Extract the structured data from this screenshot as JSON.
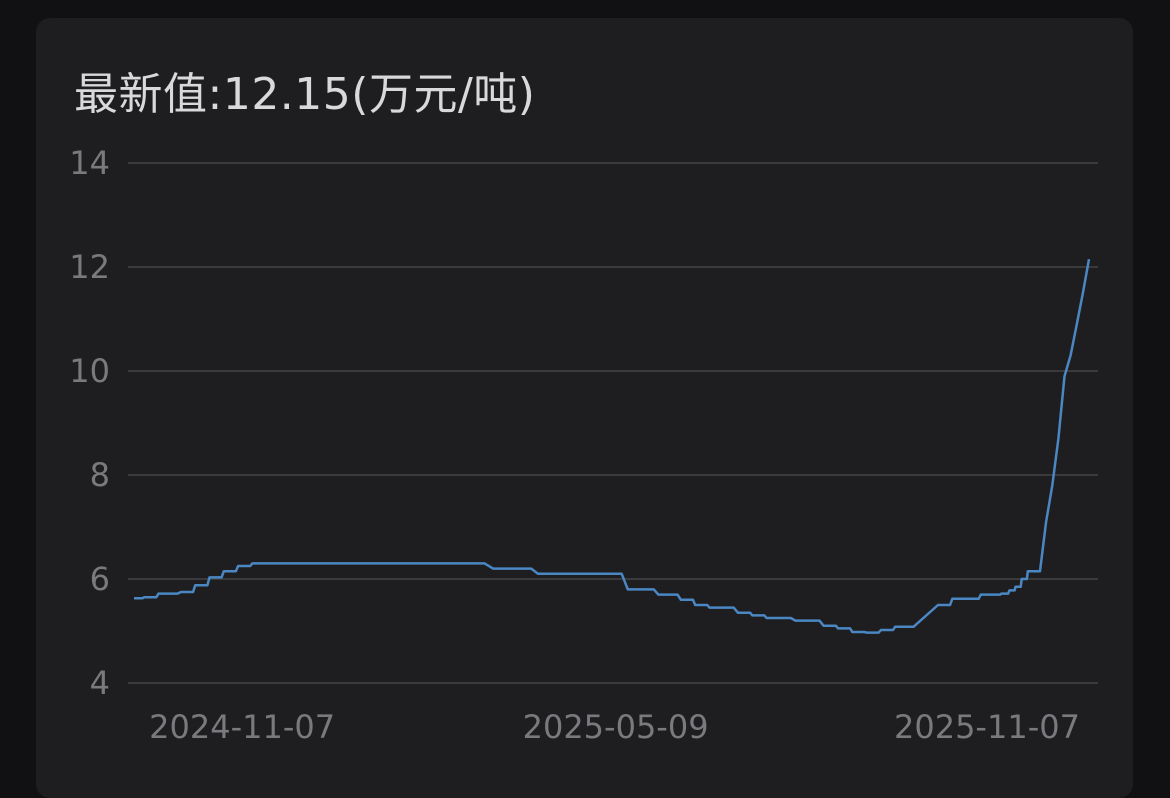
{
  "header": {
    "title": "最新值:12.15(万元/吨)"
  },
  "chart_data": {
    "type": "line",
    "title": "最新值:12.15(万元/吨)",
    "ylim": [
      4,
      14
    ],
    "yticks": [
      4,
      6,
      8,
      10,
      12,
      14
    ],
    "x_labels": [
      "2024-11-07",
      "2025-05-09",
      "2025-11-07"
    ],
    "grid": true,
    "legend": "none",
    "color": "#4a87c3",
    "series": [
      {
        "x": [
          "2024-09-15",
          "2024-09-20",
          "2024-09-27",
          "2024-10-08",
          "2024-10-15",
          "2024-10-22",
          "2024-10-29",
          "2024-11-05",
          "2024-11-12",
          "2024-11-19",
          "2024-11-26",
          "2024-12-10",
          "2024-12-20",
          "2025-01-10",
          "2025-02-10",
          "2025-03-10",
          "2025-04-01",
          "2025-04-18",
          "2025-04-25",
          "2025-05-15",
          "2025-05-30",
          "2025-06-10",
          "2025-06-17",
          "2025-06-24",
          "2025-07-08",
          "2025-07-15",
          "2025-07-22",
          "2025-08-05",
          "2025-08-19",
          "2025-08-26",
          "2025-09-02",
          "2025-09-09",
          "2025-09-16",
          "2025-09-23",
          "2025-10-02",
          "2025-10-14",
          "2025-10-21",
          "2025-10-28",
          "2025-11-04",
          "2025-11-11",
          "2025-11-14",
          "2025-11-18",
          "2025-11-21",
          "2025-11-24",
          "2025-11-27",
          "2025-11-30",
          "2025-12-03",
          "2025-12-06",
          "2025-12-09",
          "2025-12-12",
          "2025-12-15",
          "2025-12-18",
          "2025-12-21",
          "2025-12-24",
          "2025-12-27"
        ],
        "y": [
          5.63,
          5.65,
          5.72,
          5.75,
          5.88,
          6.03,
          6.15,
          6.25,
          6.3,
          6.3,
          6.3,
          6.3,
          6.3,
          6.3,
          6.3,
          6.2,
          6.1,
          6.1,
          6.1,
          5.8,
          5.7,
          5.6,
          5.5,
          5.45,
          5.35,
          5.3,
          5.25,
          5.2,
          5.1,
          5.05,
          4.98,
          4.97,
          5.02,
          5.08,
          5.08,
          5.5,
          5.62,
          5.62,
          5.7,
          5.7,
          5.72,
          5.78,
          5.85,
          6.0,
          6.15,
          6.15,
          6.15,
          7.1,
          7.8,
          8.7,
          9.9,
          10.3,
          10.9,
          11.5,
          12.15
        ]
      }
    ]
  }
}
